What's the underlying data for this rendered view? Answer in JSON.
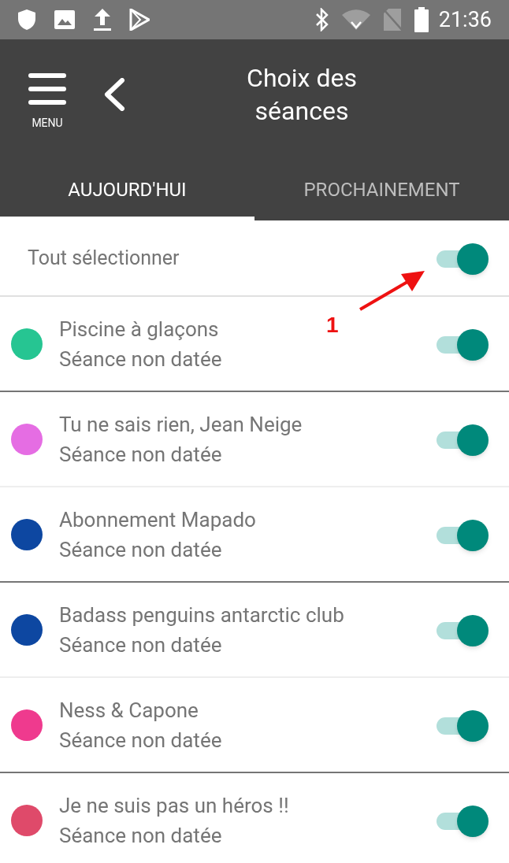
{
  "status_bar": {
    "time": "21:36"
  },
  "header": {
    "menu_label": "MENU",
    "title": "Choix des séances"
  },
  "tabs": [
    {
      "label": "AUJOURD'HUI",
      "selected": true
    },
    {
      "label": "PROCHAINEMENT",
      "selected": false
    }
  ],
  "select_all": {
    "label": "Tout sélectionner",
    "on": true
  },
  "annotation": {
    "label": "1"
  },
  "sessions": [
    {
      "name": "Piscine à glaçons",
      "subtitle": "Séance non datée",
      "color": "#26c592",
      "on": true
    },
    {
      "name": "Tu ne sais rien, Jean Neige",
      "subtitle": "Séance non datée",
      "color": "#e56de3",
      "on": true
    },
    {
      "name": "Abonnement Mapado",
      "subtitle": "Séance non datée",
      "color": "#0d47a1",
      "on": true
    },
    {
      "name": "Badass penguins antarctic club",
      "subtitle": "Séance non datée",
      "color": "#0d47a1",
      "on": true
    },
    {
      "name": "Ness & Capone",
      "subtitle": "Séance non datée",
      "color": "#ef3a8e",
      "on": true
    },
    {
      "name": "Je ne suis pas un héros !!",
      "subtitle": "Séance non datée",
      "color": "#df4a6a",
      "on": true
    }
  ]
}
